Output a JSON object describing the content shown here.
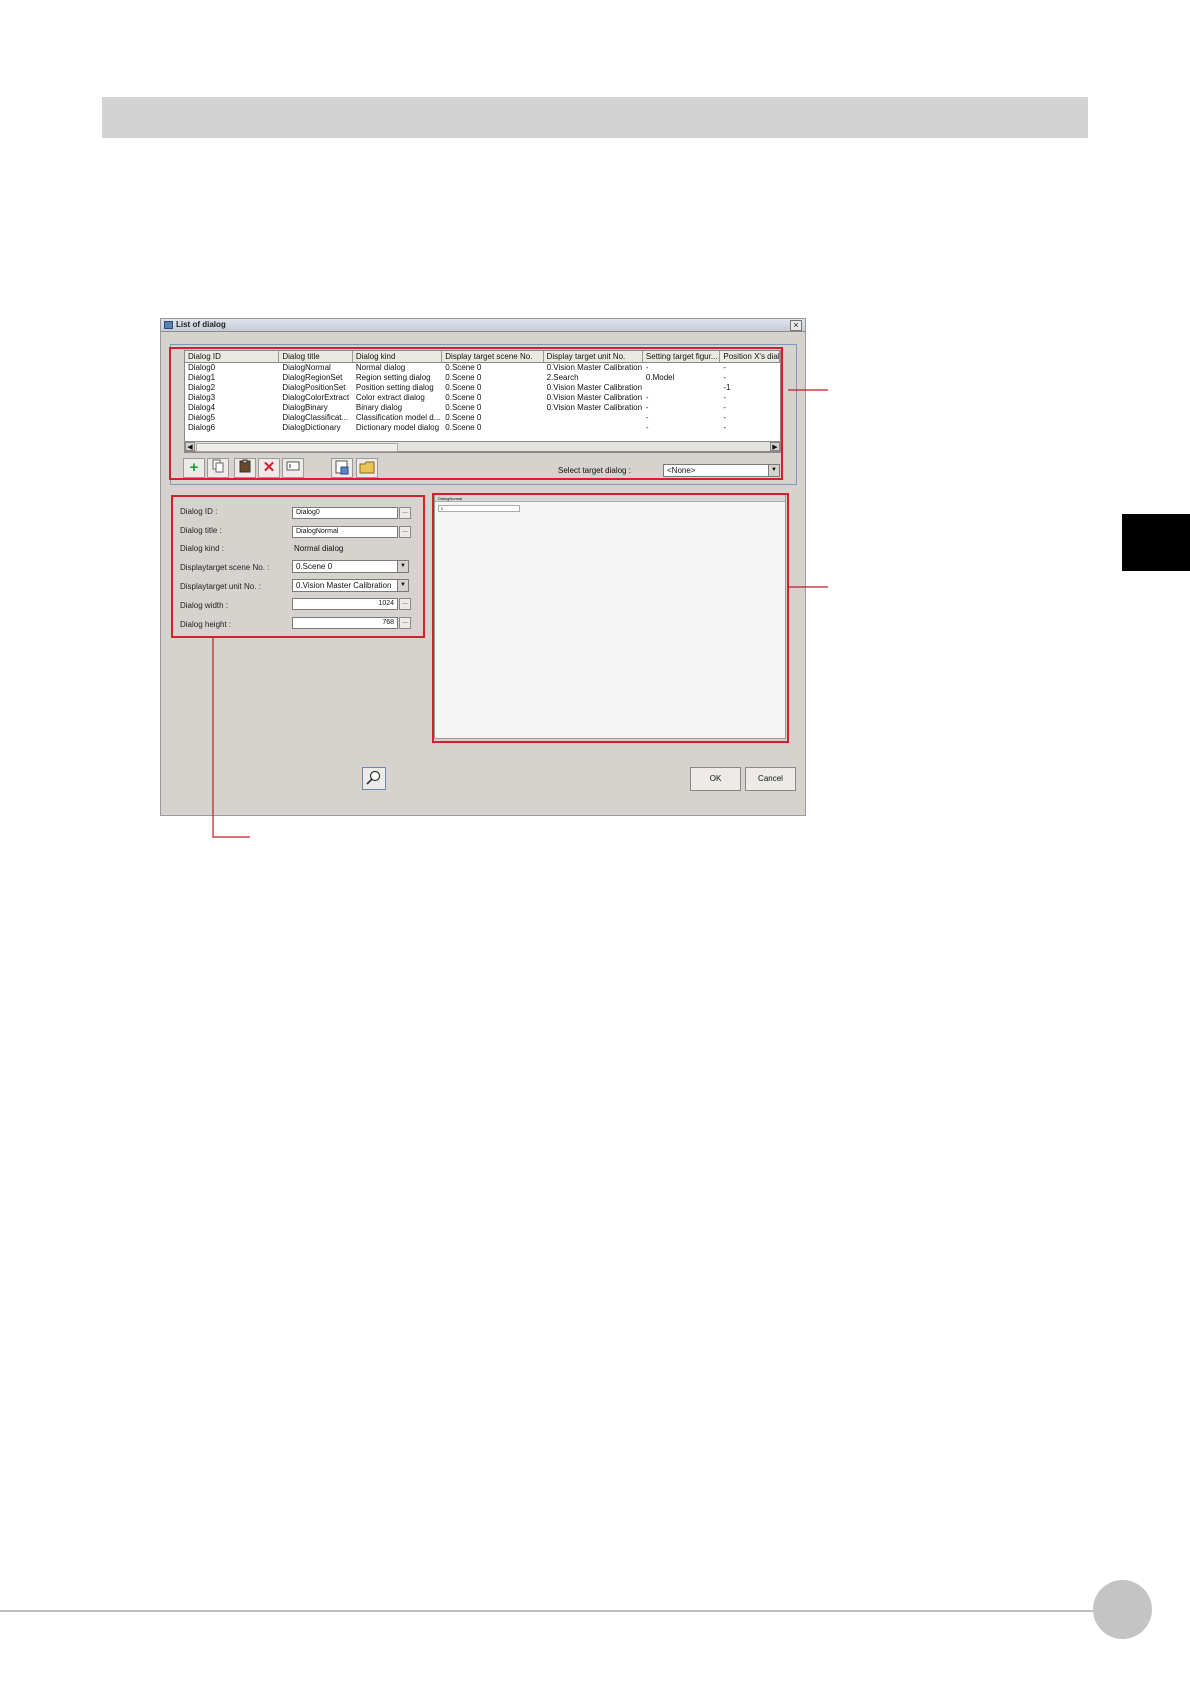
{
  "page": {
    "side_tab_color": "#000000"
  },
  "window": {
    "title": "List of dialog",
    "close_glyph": "×"
  },
  "table": {
    "headers": [
      "Dialog ID",
      "Dialog title",
      "Dialog kind",
      "Display target scene No.",
      "Display target unit No.",
      "Setting target figur...",
      "Position X's dial"
    ],
    "rows": [
      [
        "Dialog0",
        "DialogNormal",
        "Normal dialog",
        "0.Scene 0",
        "0.Vision Master Calibration",
        "-",
        "-"
      ],
      [
        "Dialog1",
        "DialogRegionSet",
        "Region setting dialog",
        "0.Scene 0",
        "2.Search",
        "0.Model",
        "-"
      ],
      [
        "Dialog2",
        "DialogPositionSet",
        "Position setting dialog",
        "0.Scene 0",
        "0.Vision Master Calibration",
        "",
        "-1"
      ],
      [
        "Dialog3",
        "DialogColorExtract",
        "Color extract dialog",
        "0.Scene 0",
        "0.Vision Master Calibration",
        "-",
        "-"
      ],
      [
        "Dialog4",
        "DialogBinary",
        "Binary dialog",
        "0.Scene 0",
        "0.Vision Master Calibration",
        "-",
        "-"
      ],
      [
        "Dialog5",
        "DialogClassificat...",
        "Classification model d...",
        "0.Scene 0",
        "",
        "-",
        "-"
      ],
      [
        "Dialog6",
        "DialogDictionary",
        "Dictionary model dialog",
        "0.Scene 0",
        "",
        "-",
        "-"
      ]
    ]
  },
  "toolbar": {
    "icons": [
      "add-icon",
      "copy-icon",
      "paste-icon",
      "delete-icon",
      "rename-icon",
      "export-icon",
      "import-icon"
    ],
    "select_label": "Select target dialog :",
    "select_value": "<None>"
  },
  "properties": {
    "dialog_id_label": "Dialog ID :",
    "dialog_id_value": "Dialog0",
    "dialog_title_label": "Dialog title :",
    "dialog_title_value": "DialogNormal",
    "dialog_kind_label": "Dialog kind :",
    "dialog_kind_value": "Normal dialog",
    "scene_label": "Displaytarget scene No. :",
    "scene_value": "0.Scene 0",
    "unit_label": "Displaytarget unit No. :",
    "unit_value": "0.Vision Master Calibration",
    "width_label": "Dialog width :",
    "width_value": "1024",
    "height_label": "Dialog height :",
    "height_value": "768",
    "dots": "..."
  },
  "preview": {
    "title": "DialogNormal",
    "field": "0"
  },
  "buttons": {
    "ok": "OK",
    "cancel": "Cancel"
  },
  "colors": {
    "callout": "#d2202f",
    "connector": "#c01a26"
  }
}
